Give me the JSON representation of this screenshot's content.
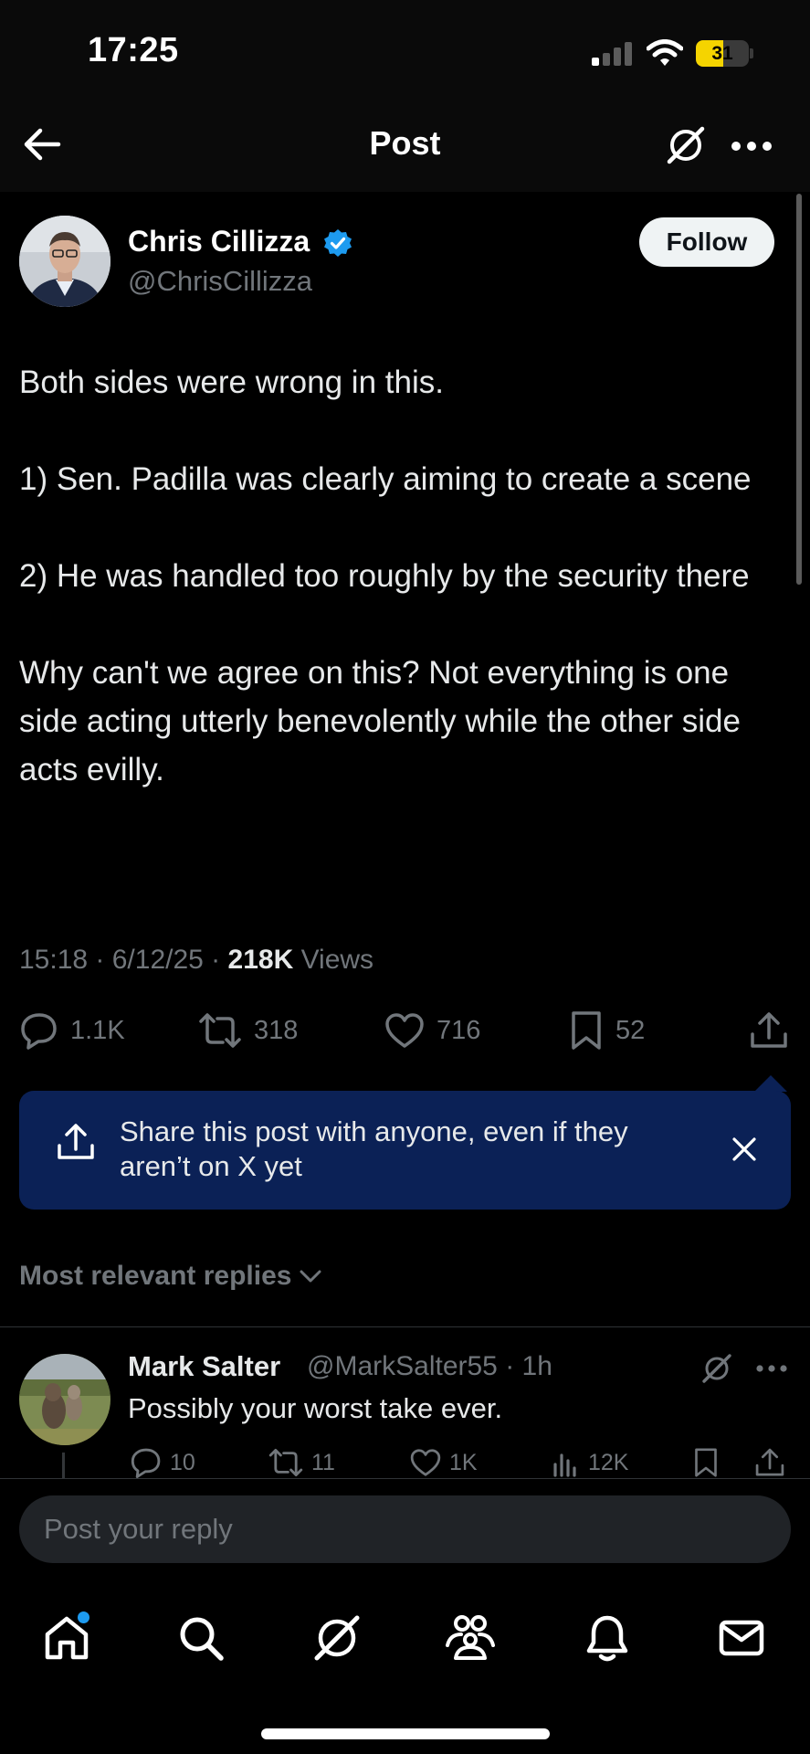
{
  "status_bar": {
    "time": "17:25",
    "battery": "31",
    "icons": [
      "signal-icon",
      "wifi-icon",
      "battery-icon"
    ]
  },
  "header": {
    "title": "Post",
    "icons": [
      "back-arrow-icon",
      "grok-icon",
      "more-icon"
    ]
  },
  "post": {
    "author_name": "Chris Cillizza",
    "author_handle": "@ChrisCillizza",
    "verified": true,
    "follow_label": "Follow",
    "paragraphs": [
      "Both sides were wrong in this.",
      "1) Sen. Padilla was clearly aiming to create a scene",
      "2) He was handled too roughly by the security there",
      "Why can't we agree on this? Not everything is one side acting utterly benevolently while the other side acts evilly."
    ],
    "time": "15:18",
    "date": "6/12/25",
    "views_count": "218K",
    "views_label": "Views",
    "replies": "1.1K",
    "reposts": "318",
    "likes": "716",
    "bookmarks": "52"
  },
  "share_banner": {
    "text": "Share this post with anyone, even if they aren’t on X yet"
  },
  "replies_sort": {
    "label": "Most relevant replies"
  },
  "reply": {
    "name": "Mark Salter",
    "handle": "@MarkSalter55",
    "time": "1h",
    "text": "Possibly your worst take ever.",
    "replies": "10",
    "reposts": "11",
    "likes": "1K",
    "views": "12K"
  },
  "compose": {
    "placeholder": "Post your reply"
  },
  "tab_bar": {
    "items": [
      "home-icon",
      "search-icon",
      "grok-icon",
      "communities-icon",
      "notifications-icon",
      "messages-icon"
    ]
  },
  "colors": {
    "accent": "#1d9bf0",
    "banner": "#0b2156",
    "muted": "#71767b",
    "battery": "#f5d400"
  }
}
